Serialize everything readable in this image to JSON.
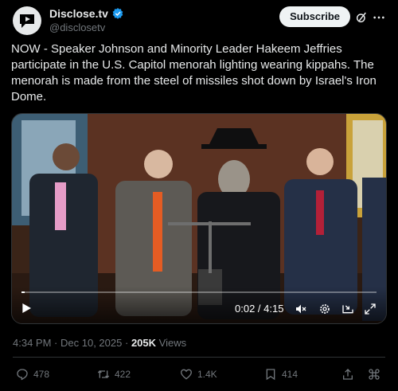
{
  "author": {
    "display_name": "Disclose.tv",
    "handle": "@disclosetv",
    "verified_color": "#1d9bf0"
  },
  "header": {
    "subscribe_label": "Subscribe"
  },
  "tweet": {
    "text": "NOW - Speaker Johnson and Minority Leader Hakeem Jeffries participate in the U.S. Capitol menorah lighting wearing kippahs. The menorah is made from the steel of missiles shot down by Israel's Iron Dome."
  },
  "video": {
    "current_time": "0:02",
    "duration": "4:15",
    "time_display": "0:02 / 4:15",
    "progress_fraction": 0.008
  },
  "meta": {
    "time": "4:34 PM",
    "date": "Dec 10, 2025",
    "separator": "·",
    "views_count": "205K",
    "views_label": "Views"
  },
  "actions": {
    "replies": "478",
    "reposts": "422",
    "likes": "1.4K",
    "bookmarks": "414"
  }
}
